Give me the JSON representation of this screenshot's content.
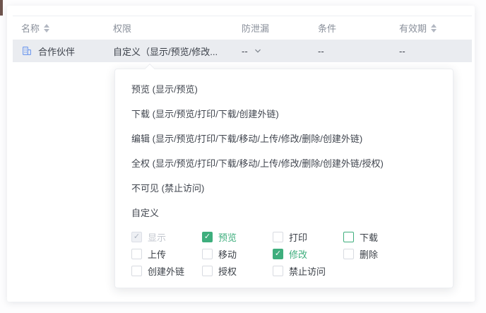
{
  "colors": {
    "green": "#3eae7d",
    "icon_blue": "#6f99ee",
    "row_highlight": "#eaecf0",
    "header_text": "#8a909b"
  },
  "table": {
    "columns": [
      {
        "label": "名称",
        "sortable": true
      },
      {
        "label": "权限",
        "sortable": false
      },
      {
        "label": "防泄漏",
        "sortable": false
      },
      {
        "label": "条件",
        "sortable": false
      },
      {
        "label": "有效期",
        "sortable": true
      }
    ],
    "row": {
      "name": "合作伙伴",
      "name_icon": "organization-icon",
      "permission": "自定义（显示/预览/修改...",
      "leak_prevention": "--",
      "condition": "--",
      "validity": "--"
    }
  },
  "dropdown": {
    "items": [
      "预览 (显示/预览)",
      "下载 (显示/预览/打印/下载/创建外链)",
      "编辑 (显示/预览/打印/下载/移动/上传/修改/删除/创建外链)",
      "全权 (显示/预览/打印/下载/移动/上传/修改/删除/创建外链/授权)",
      "不可见 (禁止访问)",
      "自定义"
    ],
    "checkboxes": [
      {
        "label": "显示",
        "checked": true,
        "disabled": true,
        "hover": false
      },
      {
        "label": "预览",
        "checked": true,
        "disabled": false,
        "hover": false
      },
      {
        "label": "打印",
        "checked": false,
        "disabled": false,
        "hover": false
      },
      {
        "label": "下载",
        "checked": false,
        "disabled": false,
        "hover": true
      },
      {
        "label": "上传",
        "checked": false,
        "disabled": false,
        "hover": false
      },
      {
        "label": "移动",
        "checked": false,
        "disabled": false,
        "hover": false
      },
      {
        "label": "修改",
        "checked": true,
        "disabled": false,
        "hover": false
      },
      {
        "label": "删除",
        "checked": false,
        "disabled": false,
        "hover": false
      },
      {
        "label": "创建外链",
        "checked": false,
        "disabled": false,
        "hover": false
      },
      {
        "label": "授权",
        "checked": false,
        "disabled": false,
        "hover": false
      },
      {
        "label": "禁止访问",
        "checked": false,
        "disabled": false,
        "hover": false
      }
    ],
    "check_glyph": "✓"
  }
}
